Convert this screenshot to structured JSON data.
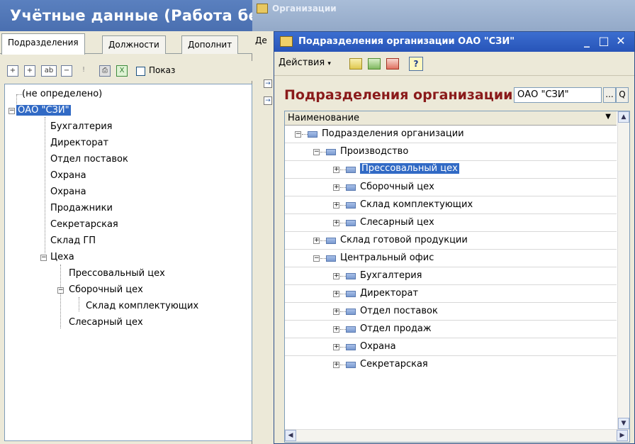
{
  "back_window": {
    "title": "Учётные данные (Работа без к",
    "tabs": [
      "Подразделения",
      "Должности",
      "Дополнит"
    ],
    "show_checkbox_label": "Показ",
    "tree": [
      {
        "label": "(не определено)",
        "level": 0,
        "expander": ""
      },
      {
        "label": "ОАО \"СЗИ\"",
        "level": 0,
        "expander": "-",
        "selected": true
      },
      {
        "label": "Бухгалтерия",
        "level": 1,
        "expander": ""
      },
      {
        "label": "Директорат",
        "level": 1,
        "expander": ""
      },
      {
        "label": "Отдел поставок",
        "level": 1,
        "expander": ""
      },
      {
        "label": "Охрана",
        "level": 1,
        "expander": ""
      },
      {
        "label": "Охрана",
        "level": 1,
        "expander": ""
      },
      {
        "label": "Продажники",
        "level": 1,
        "expander": ""
      },
      {
        "label": "Секретарская",
        "level": 1,
        "expander": ""
      },
      {
        "label": "Склад ГП",
        "level": 1,
        "expander": ""
      },
      {
        "label": "Цеха",
        "level": 1,
        "expander": "-"
      },
      {
        "label": "Прессовальный цех",
        "level": 2,
        "expander": ""
      },
      {
        "label": "Сборочный цех",
        "level": 2,
        "expander": "-"
      },
      {
        "label": "Склад комплектующих",
        "level": 3,
        "expander": ""
      },
      {
        "label": "Слесарный цех",
        "level": 2,
        "expander": ""
      }
    ]
  },
  "middle_window": {
    "title": "Организации",
    "tab_label": "Де"
  },
  "front_window": {
    "title": "Подразделения организации ОАО \"СЗИ\"",
    "actions_label": "Действия",
    "help_label": "?",
    "heading": "Подразделения организации",
    "org_value": "ОАО \"СЗИ\"",
    "select_button": "...",
    "search_button": "Q",
    "column_header": "Наименование",
    "rows": [
      {
        "label": "Подразделения организации",
        "level": 0,
        "expander": "-"
      },
      {
        "label": "Производство",
        "level": 1,
        "expander": "-"
      },
      {
        "label": "Прессовальный цех",
        "level": 2,
        "expander": "+",
        "selected": true
      },
      {
        "label": "Сборочный цех",
        "level": 2,
        "expander": "+"
      },
      {
        "label": "Склад комплектующих",
        "level": 2,
        "expander": "+"
      },
      {
        "label": "Слесарный цех",
        "level": 2,
        "expander": "+"
      },
      {
        "label": "Склад готовой продукции",
        "level": 1,
        "expander": "+"
      },
      {
        "label": "Центральный офис",
        "level": 1,
        "expander": "-"
      },
      {
        "label": "Бухгалтерия",
        "level": 2,
        "expander": "+"
      },
      {
        "label": "Директорат",
        "level": 2,
        "expander": "+"
      },
      {
        "label": "Отдел поставок",
        "level": 2,
        "expander": "+"
      },
      {
        "label": "Отдел продаж",
        "level": 2,
        "expander": "+"
      },
      {
        "label": "Охрана",
        "level": 2,
        "expander": "+"
      },
      {
        "label": "Секретарская",
        "level": 2,
        "expander": "+"
      }
    ]
  },
  "colors": {
    "selection": "#316ac5",
    "heading": "#8a1a1a",
    "title_bar": "#2754b8"
  }
}
